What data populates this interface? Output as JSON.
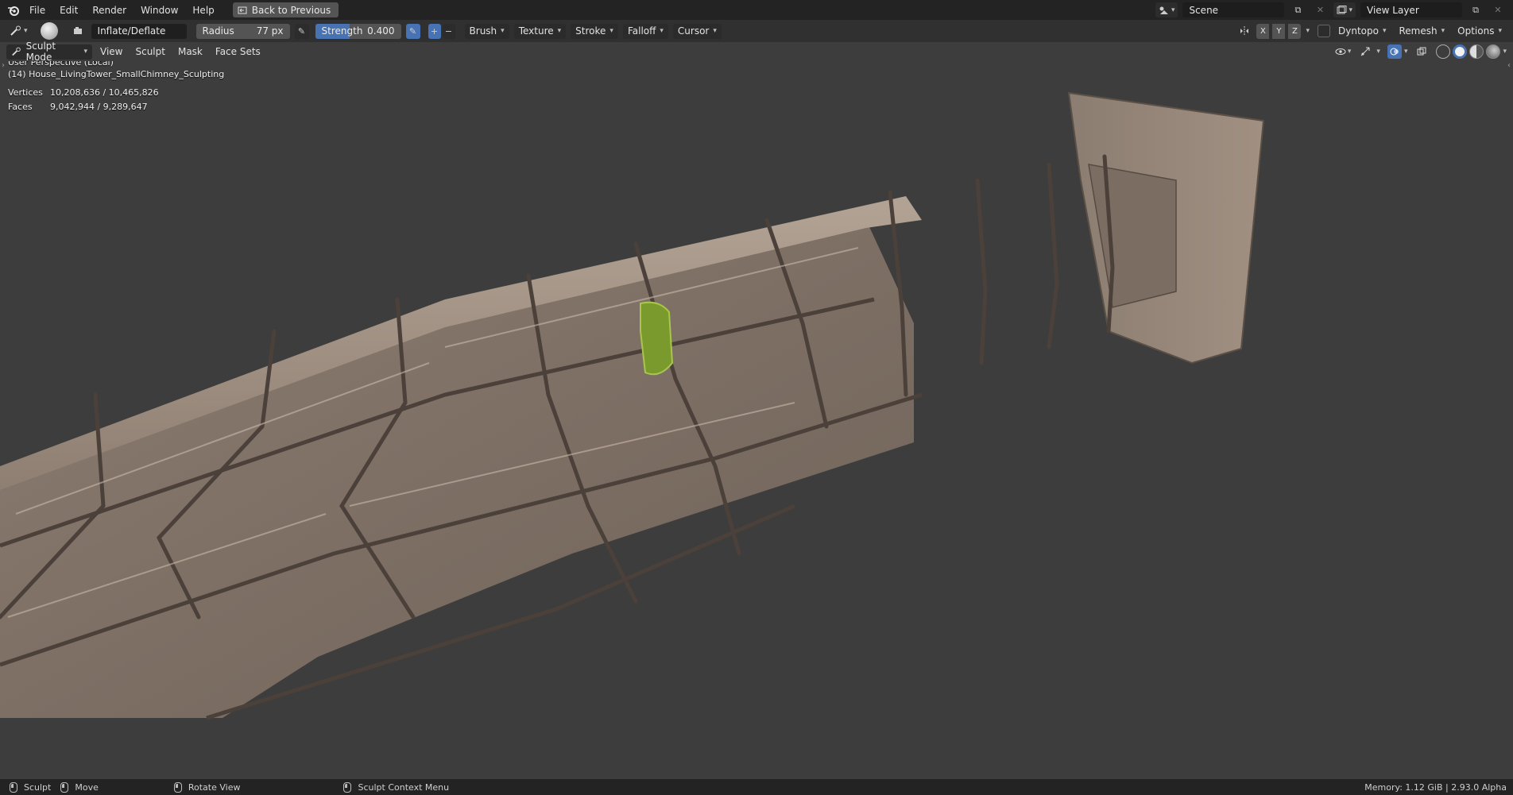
{
  "menubar": {
    "items": [
      "File",
      "Edit",
      "Render",
      "Window",
      "Help"
    ],
    "back_button": "Back to Previous",
    "scene": "Scene",
    "view_layer": "View Layer"
  },
  "toolbar": {
    "brush_name": "Inflate/Deflate",
    "radius_label": "Radius",
    "radius_value": "77 px",
    "strength_label": "Strength",
    "strength_value": "0.400",
    "strength_fraction": 0.4,
    "dropdowns": [
      "Brush",
      "Texture",
      "Stroke",
      "Falloff",
      "Cursor"
    ],
    "axes": [
      "X",
      "Y",
      "Z"
    ],
    "dyntopo": "Dyntopo",
    "remesh": "Remesh",
    "options": "Options"
  },
  "modebar": {
    "mode": "Sculpt Mode",
    "menus": [
      "View",
      "Sculpt",
      "Mask",
      "Face Sets"
    ]
  },
  "viewport": {
    "perspective": "User Perspective (Local)",
    "object_name": "(14) House_LivingTower_SmallChimney_Sculpting",
    "vertices_label": "Vertices",
    "vertices_value": "10,208,636 / 10,465,826",
    "faces_label": "Faces",
    "faces_value": "9,042,944 / 9,289,647"
  },
  "statusbar": {
    "items": [
      "Sculpt",
      "Move",
      "Rotate View",
      "Sculpt Context Menu"
    ],
    "memory": "Memory: 1.12 GiB | 2.93.0 Alpha"
  },
  "colors": {
    "accent": "#4772b3",
    "stone": "#8a7c70",
    "highlight_green": "#7a9a2e"
  }
}
